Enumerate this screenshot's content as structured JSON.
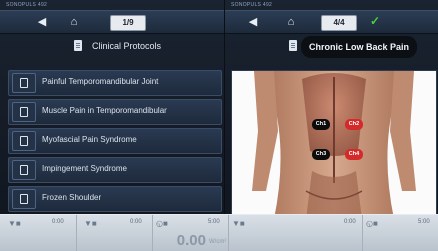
{
  "left": {
    "brand": "SONOPULS 492",
    "page_indicator": "1/9",
    "title": "Clinical Protocols",
    "items": [
      "Painful Temporomandibular Joint",
      "Muscle Pain in Temporomandibular",
      "Myofascial Pain Syndrome",
      "Impingement Syndrome",
      "Frozen Shoulder"
    ]
  },
  "right": {
    "brand": "SONOPULS 492",
    "page_indicator": "4/4",
    "title": "Chronic Low Back Pain",
    "channels": [
      "Ch1",
      "Ch2",
      "Ch3",
      "Ch4"
    ]
  },
  "bottom": {
    "ch1_value": "0:00",
    "ch2_value": "0:00",
    "time_value": "5:00",
    "intensity": "0.00",
    "intensity_unit": "W/cm²",
    "r1_value": "0:00",
    "r2_value": "5:00"
  },
  "colors": {
    "accent": "#2c3d54",
    "channel_red": "#d42a2a",
    "channel_black": "#0c0c0c",
    "check": "#4bd03a"
  }
}
